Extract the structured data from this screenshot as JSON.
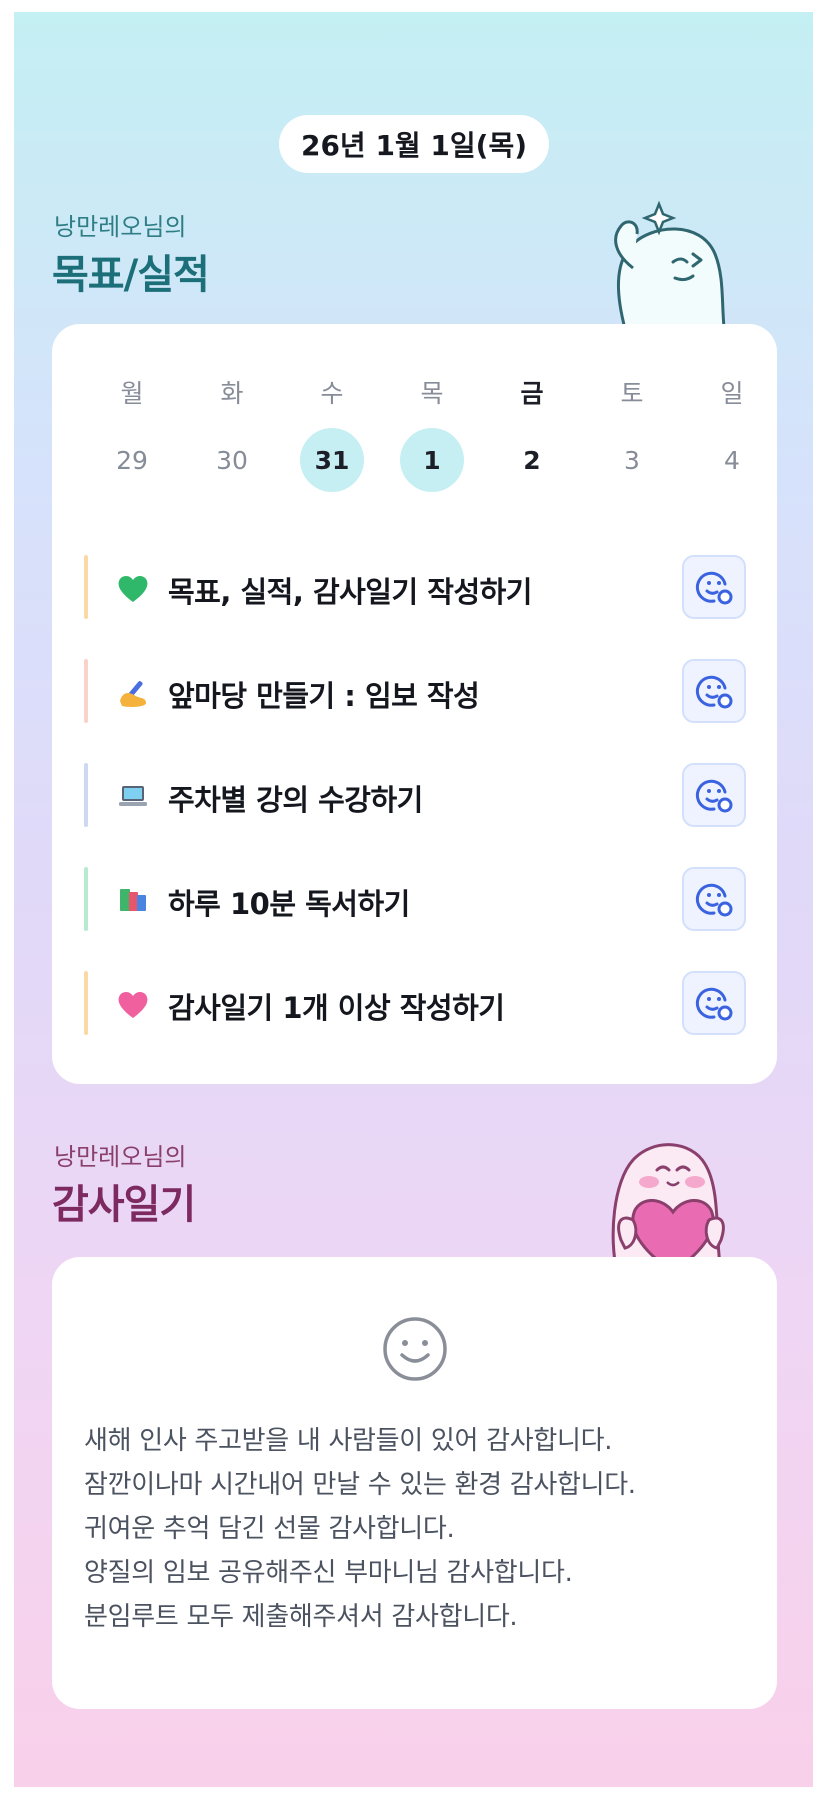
{
  "header": {
    "date": "26년 1월 1일(목)"
  },
  "goals_section": {
    "owner": "낭만레오님의",
    "title": "목표/실적"
  },
  "week": [
    {
      "day": "월",
      "num": "29",
      "state": "past"
    },
    {
      "day": "화",
      "num": "30",
      "state": "past"
    },
    {
      "day": "수",
      "num": "31",
      "state": "done"
    },
    {
      "day": "목",
      "num": "1",
      "state": "done"
    },
    {
      "day": "금",
      "num": "2",
      "state": "today"
    },
    {
      "day": "토",
      "num": "3",
      "state": "future"
    },
    {
      "day": "일",
      "num": "4",
      "state": "future"
    }
  ],
  "goals": [
    {
      "icon": "green-heart-icon",
      "text": "목표, 실적, 감사일기 작성하기",
      "accent": "#fbd9a4"
    },
    {
      "icon": "writing-hand-icon",
      "text": "앞마당 만들기 : 임보 작성",
      "accent": "#f9d3c9"
    },
    {
      "icon": "laptop-icon",
      "text": "주차별 강의 수강하기",
      "accent": "#cdd8f5"
    },
    {
      "icon": "books-icon",
      "text": "하루 10분 독서하기",
      "accent": "#b8ead1"
    },
    {
      "icon": "pink-heart-icon",
      "text": "감사일기 1개 이상 작성하기",
      "accent": "#fbd9a4"
    }
  ],
  "gratitude_section": {
    "owner": "낭만레오님의",
    "title": "감사일기",
    "entries": [
      "새해 인사 주고받을 내 사람들이 있어 감사합니다.",
      "잠깐이나마 시간내어 만날 수 있는 환경 감사합니다.",
      "귀여운 추억 담긴 선물 감사합니다.",
      "양질의 임보 공유해주신 부마니님 감사합니다.",
      "분임루트 모두 제출해주셔서 감사합니다."
    ]
  },
  "colors": {
    "accent_teal": "#1c6f78",
    "accent_plum": "#7c2a60",
    "done_day_bg": "#c6eff3",
    "feedback_button_icon": "#3b63e0"
  }
}
